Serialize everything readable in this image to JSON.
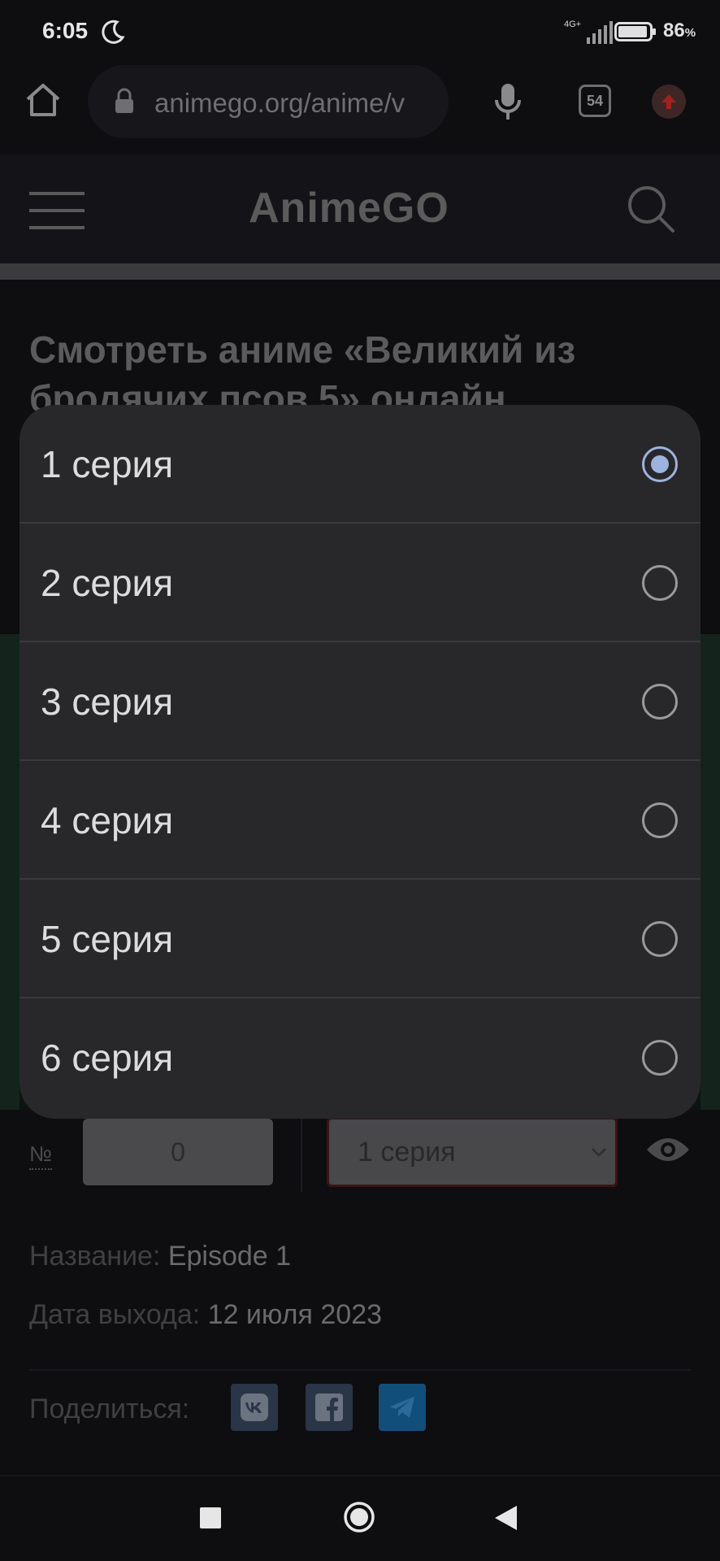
{
  "status_bar": {
    "time": "6:05",
    "network": "4G+",
    "battery_value": "86",
    "battery_unit": "%"
  },
  "browser": {
    "url": "animego.org/anime/v",
    "tabs_count": "54"
  },
  "site": {
    "logo": "AnimeGO"
  },
  "page": {
    "title": "Смотреть аниме «Великий из бродячих псов 5» онлайн"
  },
  "controls": {
    "number_label": "№",
    "number_value": "0",
    "selected_episode": "1 серия"
  },
  "info": {
    "name_label": "Название:",
    "name_value": "Episode 1",
    "date_label": "Дата выхода:",
    "date_value": "12 июля 2023",
    "share_label": "Поделиться:"
  },
  "dialog": {
    "options": [
      {
        "label": "1 серия",
        "selected": true
      },
      {
        "label": "2 серия",
        "selected": false
      },
      {
        "label": "3 серия",
        "selected": false
      },
      {
        "label": "4 серия",
        "selected": false
      },
      {
        "label": "5 серия",
        "selected": false
      },
      {
        "label": "6 серия",
        "selected": false
      }
    ]
  },
  "colors": {
    "accent_radio": "#9db3df",
    "dialog_bg": "#28272a",
    "telegram": "#114f7a"
  }
}
